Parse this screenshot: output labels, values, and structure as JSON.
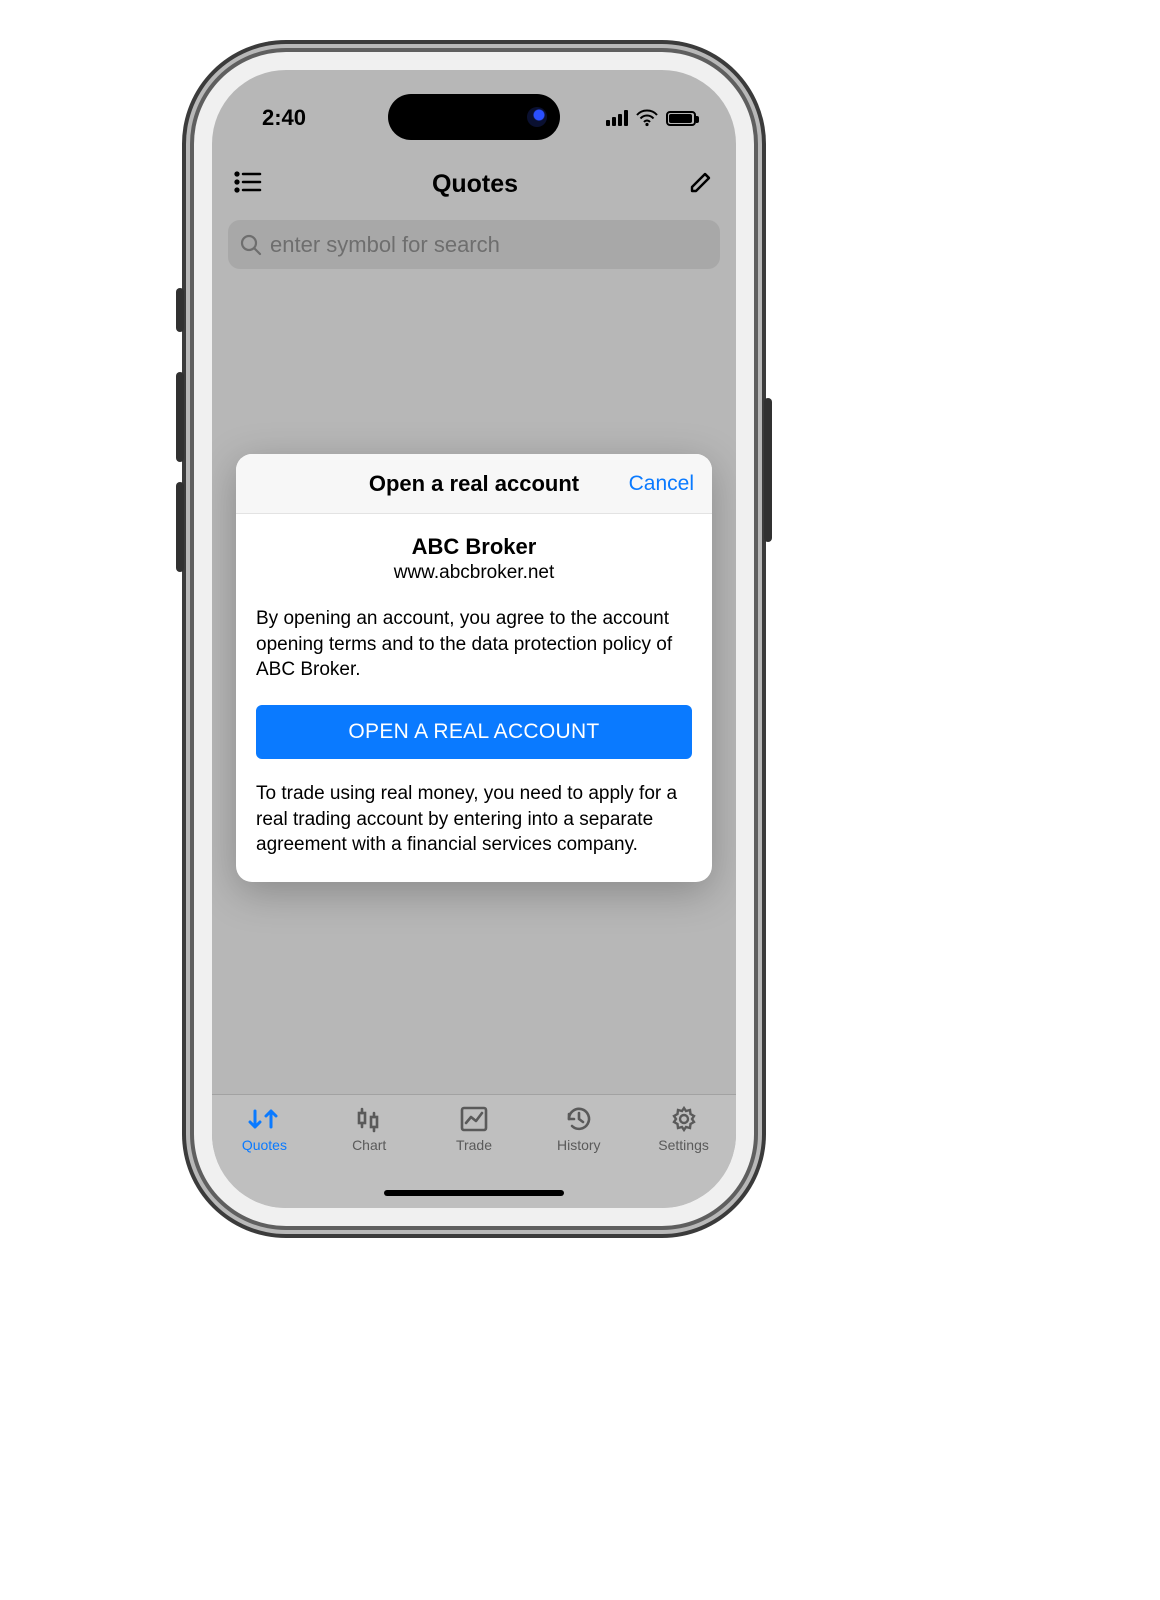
{
  "status": {
    "time": "2:40"
  },
  "navbar": {
    "title": "Quotes"
  },
  "search": {
    "placeholder": "enter symbol for search"
  },
  "modal": {
    "title": "Open a real account",
    "cancel": "Cancel",
    "broker_name": "ABC Broker",
    "broker_url": "www.abcbroker.net",
    "terms": "By opening an account, you agree to the account opening terms and to the data protection policy of ABC Broker.",
    "button": "OPEN A REAL ACCOUNT",
    "note": "To trade using real money, you need to apply for a real trading account by entering into a separate agreement with a financial services company."
  },
  "tabs": {
    "quotes": "Quotes",
    "chart": "Chart",
    "trade": "Trade",
    "history": "History",
    "settings": "Settings"
  }
}
